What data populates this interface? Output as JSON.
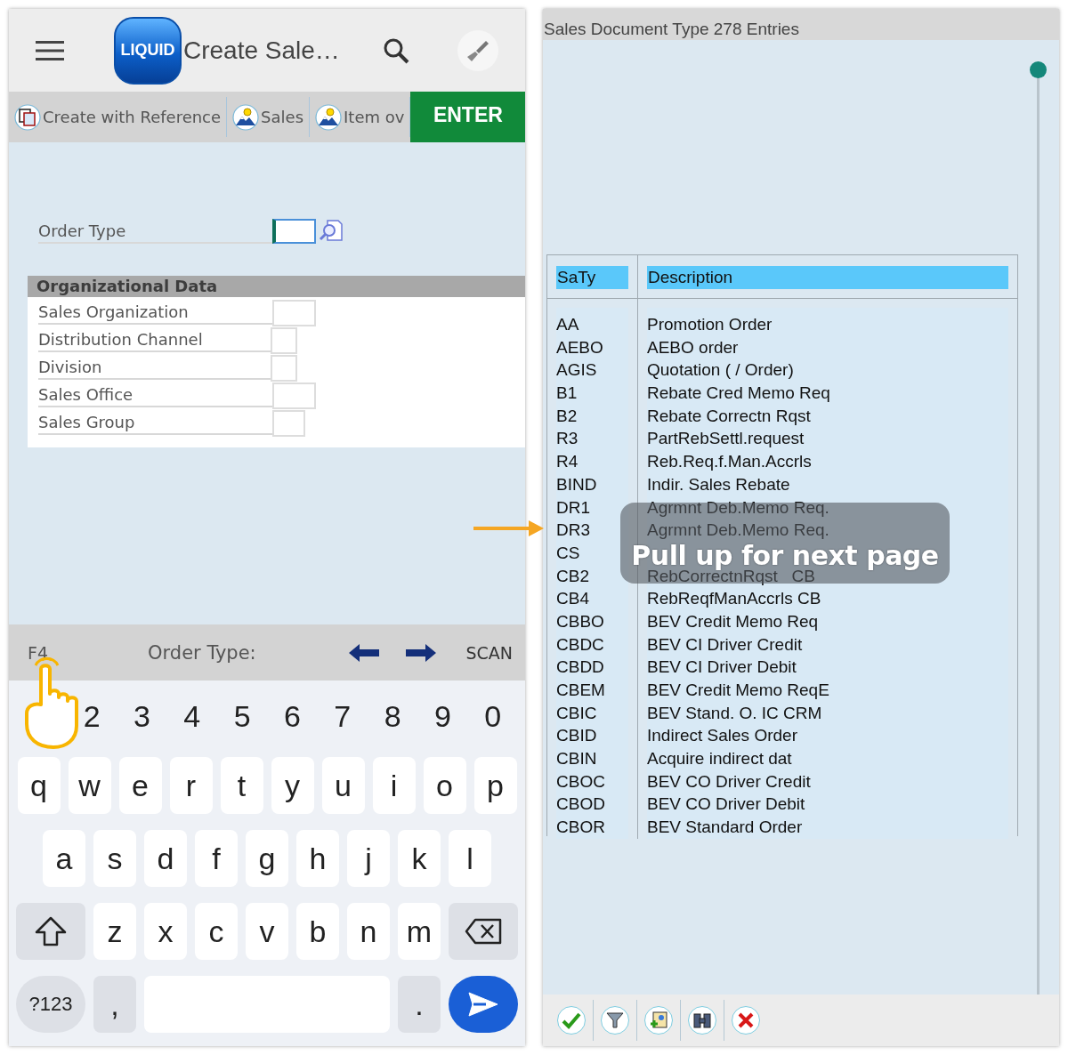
{
  "app_bar": {
    "logo": "LIQUID",
    "title": "Create Sale…"
  },
  "toolbar": {
    "buttons": [
      {
        "kind": "reference",
        "label": "Create with Reference"
      },
      {
        "kind": "image",
        "label": "Sales"
      },
      {
        "kind": "image",
        "label": "Item ov"
      }
    ],
    "enter": "ENTER"
  },
  "order_type": {
    "label": "Order Type",
    "focused": true
  },
  "organizational_data": {
    "title": "Organizational Data",
    "fields": [
      {
        "label": "Sales Organization"
      },
      {
        "label": "Distribution Channel"
      },
      {
        "label": "Division"
      },
      {
        "label": "Sales Office"
      },
      {
        "label": "Sales Group"
      }
    ]
  },
  "keyboard_bar": {
    "key": "F4",
    "prompt": "Order Type:",
    "scan": "SCAN"
  },
  "keyboard": {
    "digits": [
      "2",
      "3",
      "4",
      "5",
      "6",
      "7",
      "8",
      "9",
      "0"
    ],
    "key_rows": [
      {
        "keys": [
          {
            "kind": "char",
            "label": "q"
          },
          {
            "kind": "char",
            "label": "w"
          },
          {
            "kind": "char",
            "label": "e"
          },
          {
            "kind": "char",
            "label": "r"
          },
          {
            "kind": "char",
            "label": "t"
          },
          {
            "kind": "char",
            "label": "y"
          },
          {
            "kind": "char",
            "label": "u"
          },
          {
            "kind": "char",
            "label": "i"
          },
          {
            "kind": "char",
            "label": "o"
          },
          {
            "kind": "char",
            "label": "p"
          }
        ]
      },
      {
        "keys": [
          {
            "kind": "char",
            "label": "a"
          },
          {
            "kind": "char",
            "label": "s"
          },
          {
            "kind": "char",
            "label": "d"
          },
          {
            "kind": "char",
            "label": "f"
          },
          {
            "kind": "char",
            "label": "g"
          },
          {
            "kind": "char",
            "label": "h"
          },
          {
            "kind": "char",
            "label": "j"
          },
          {
            "kind": "char",
            "label": "k"
          },
          {
            "kind": "char",
            "label": "l"
          }
        ]
      },
      {
        "keys": [
          {
            "kind": "shift"
          },
          {
            "kind": "char",
            "label": "z"
          },
          {
            "kind": "char",
            "label": "x"
          },
          {
            "kind": "char",
            "label": "c"
          },
          {
            "kind": "char",
            "label": "v"
          },
          {
            "kind": "char",
            "label": "b"
          },
          {
            "kind": "char",
            "label": "n"
          },
          {
            "kind": "char",
            "label": "m"
          },
          {
            "kind": "backspace"
          }
        ]
      },
      {
        "keys": [
          {
            "kind": "symbols",
            "label": "?123"
          },
          {
            "kind": "punct",
            "label": ","
          },
          {
            "kind": "space"
          },
          {
            "kind": "punct",
            "label": "."
          },
          {
            "kind": "send"
          }
        ]
      }
    ]
  },
  "value_list": {
    "title": "Sales Document Type 278 Entries",
    "columns": [
      "SaTy",
      "Description"
    ],
    "rows": [
      [
        "AA",
        "Promotion Order"
      ],
      [
        "AEBO",
        "AEBO order"
      ],
      [
        "AGIS",
        "Quotation ( / Order)"
      ],
      [
        "B1",
        "Rebate Cred Memo Req"
      ],
      [
        "B2",
        "Rebate Correctn Rqst"
      ],
      [
        "R3",
        "PartRebSettl.request"
      ],
      [
        "R4",
        "Reb.Req.f.Man.Accrls"
      ],
      [
        "BIND",
        "Indir. Sales Rebate"
      ],
      [
        "DR1",
        "Agrmnt Deb.Memo Req."
      ],
      [
        "DR3",
        "Agrmnt Deb.Memo Req."
      ],
      [
        "CS"
      ],
      [
        "CB2",
        "RebCorrectnRqst   CB"
      ],
      [
        "CB4",
        "RebReqfManAccrls CB"
      ],
      [
        "CBBO",
        "BEV Credit Memo Req"
      ],
      [
        "CBDC",
        "BEV CI Driver Credit"
      ],
      [
        "CBDD",
        "BEV CI Driver Debit"
      ],
      [
        "CBEM",
        "BEV Credit Memo ReqE"
      ],
      [
        "CBIC",
        "BEV Stand. O. IC CRM"
      ],
      [
        "CBID",
        "Indirect Sales Order"
      ],
      [
        "CBIN",
        "Acquire indirect dat"
      ],
      [
        "CBOC",
        "BEV CO Driver Credit"
      ],
      [
        "CBOD",
        "BEV CO Driver Debit"
      ],
      [
        "CBOR",
        "BEV Standard Order"
      ]
    ],
    "hint": "Pull up for next page",
    "actions": [
      {
        "kind": "confirm"
      },
      {
        "kind": "filter"
      },
      {
        "kind": "new"
      },
      {
        "kind": "find"
      },
      {
        "kind": "cancel"
      }
    ]
  }
}
